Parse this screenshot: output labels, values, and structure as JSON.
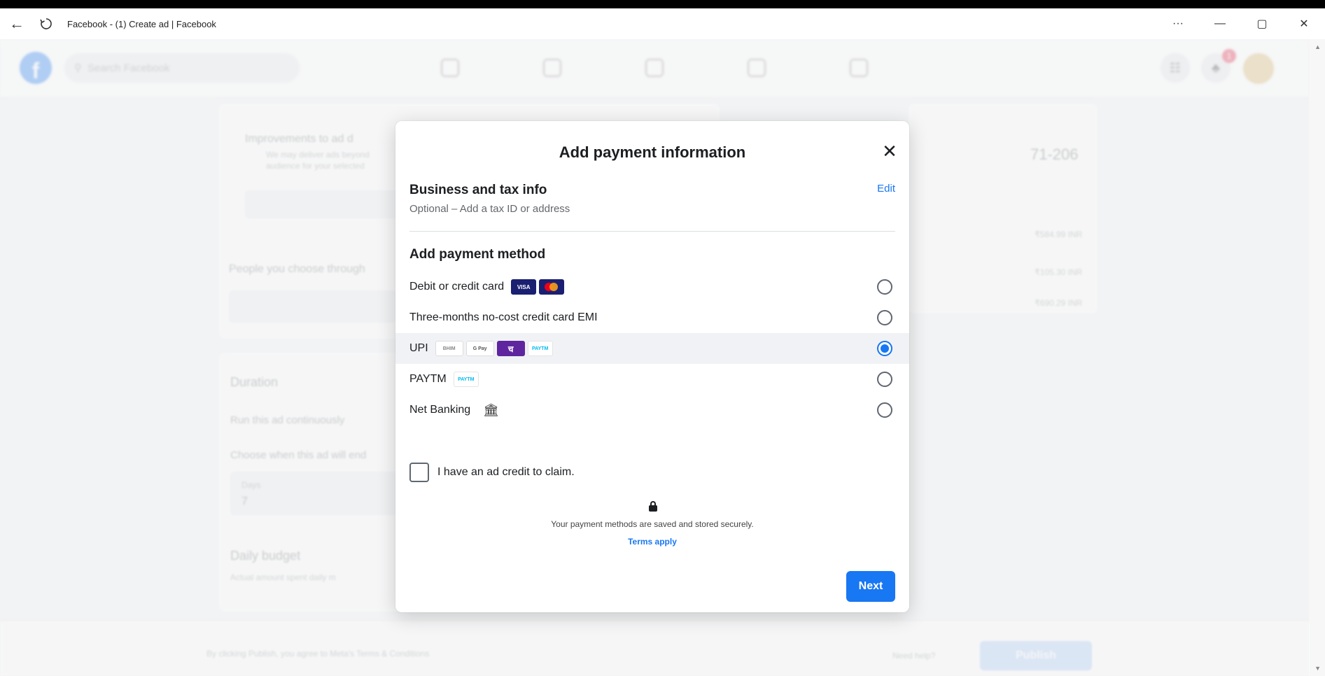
{
  "browser": {
    "tab_title": "Facebook - (1) Create ad | Facebook",
    "controls": {
      "more": "···",
      "minimize": "—",
      "restore": "▢",
      "close": "✕"
    },
    "back_glyph": "←"
  },
  "fb_nav": {
    "search_placeholder": "Search Facebook",
    "notification_count": "1",
    "icons": [
      "home-icon",
      "flag-icon",
      "marketplace-icon",
      "megaphone-icon",
      "video-icon"
    ]
  },
  "background": {
    "notice_title": "Improvements to ad d",
    "notice_line1": "We may deliver ads beyond",
    "notice_line2": "audience for your selected",
    "right_value": "71-206",
    "people_text": "People you choose through",
    "price1": "₹584.99 INR",
    "price2": "₹105.30 INR",
    "price3": "₹690.29 INR",
    "duration_label": "Duration",
    "run_continuously": "Run this ad continuously",
    "choose_end": "Choose when this ad will end",
    "days_label": "Days",
    "days_value": "7",
    "daily_budget": "Daily budget",
    "actual_amount": "Actual amount spent daily m",
    "footer_text": "By clicking Publish, you agree to Meta's Terms & Conditions",
    "need_help": "Need help?",
    "publish": "Publish"
  },
  "modal": {
    "title": "Add payment information",
    "close_glyph": "✕",
    "business": {
      "heading": "Business and tax info",
      "subtext": "Optional – Add a tax ID or address",
      "edit": "Edit"
    },
    "payment_heading": "Add payment method",
    "methods": [
      {
        "label": "Debit or credit card",
        "logos": [
          "VISA",
          ""
        ],
        "selected": false
      },
      {
        "label": "Three-months no-cost credit card EMI",
        "logos": [],
        "selected": false
      },
      {
        "label": "UPI",
        "logos": [
          "BHIM",
          "G Pay",
          "च",
          "PAYTM"
        ],
        "selected": true
      },
      {
        "label": "PAYTM",
        "logos": [
          "PAYTM"
        ],
        "selected": false
      },
      {
        "label": "Net Banking",
        "logos": [
          "bank-icon"
        ],
        "selected": false
      }
    ],
    "ad_credit": "I have an ad credit to claim.",
    "secure_text": "Your payment methods are saved and stored securely.",
    "terms": "Terms apply",
    "next": "Next",
    "accent": "#1877f2"
  }
}
